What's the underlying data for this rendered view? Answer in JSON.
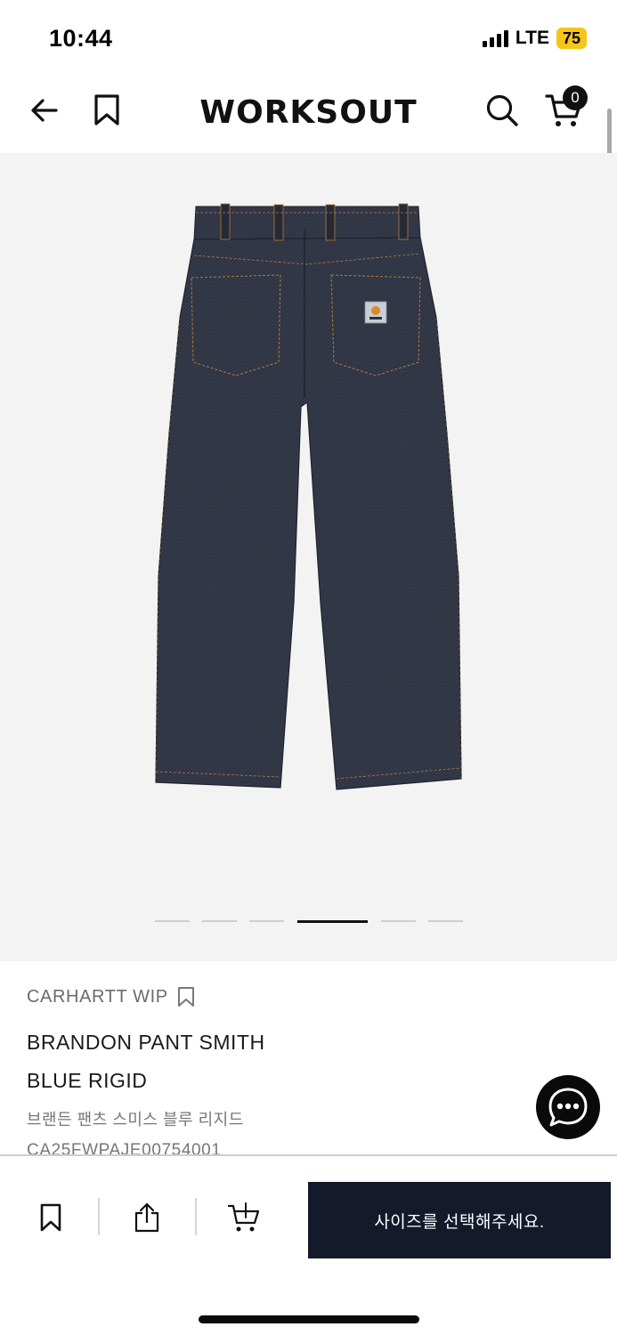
{
  "status_bar": {
    "time": "10:44",
    "network": "LTE",
    "battery": "75"
  },
  "header": {
    "brand": "WORKSOUT",
    "cart_count": "0"
  },
  "gallery": {
    "image_alt": "BRANDON PANT SMITH BLUE RIGID",
    "slide_count": 6,
    "active_slide": 4
  },
  "product": {
    "brand": "CARHARTT WIP",
    "title_line1": "BRANDON PANT SMITH",
    "title_line2": "BLUE RIGID",
    "korean_name": "브랜든 팬츠 스미스 블루 리지드",
    "sku": "CA25FWPAJE00754001"
  },
  "bottom_bar": {
    "cta_label": "사이즈를 선택해주세요."
  },
  "colors": {
    "cta_background": "#141a2a",
    "badge_background": "#111111",
    "battery_background": "#f5c518",
    "image_background": "#f3f3f3"
  },
  "icons": {
    "back": "arrow-left-icon",
    "bookmark": "bookmark-icon",
    "search": "search-icon",
    "cart": "cart-icon",
    "share": "share-icon",
    "add_to_cart": "cart-plus-icon",
    "chat": "chat-icon"
  }
}
